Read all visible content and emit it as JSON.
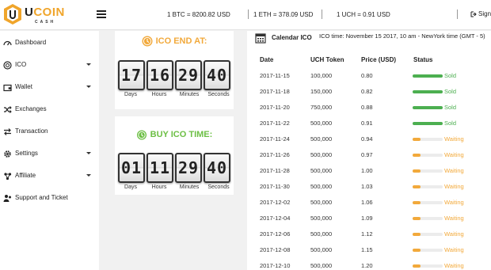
{
  "brand": {
    "name_a": "U",
    "name_b": "COIN",
    "sub": "CASH",
    "primary_color": "#f0a52b"
  },
  "header": {
    "rates": [
      "1 BTC = 8200.82 USD",
      "1 ETH = 378.09 USD",
      "1 UCH = 0.91 USD"
    ],
    "signin": "Sign"
  },
  "sidebar": {
    "items": [
      {
        "label": "Dashboard",
        "icon": "dashboard-icon",
        "has_caret": false
      },
      {
        "label": "ICO",
        "icon": "ico-coin-icon",
        "has_caret": true
      },
      {
        "label": "Wallet",
        "icon": "wallet-icon",
        "has_caret": true
      },
      {
        "label": "Exchanges",
        "icon": "shuffle-icon",
        "has_caret": false
      },
      {
        "label": "Transaction",
        "icon": "transaction-icon",
        "has_caret": false
      },
      {
        "label": "Settings",
        "icon": "gear-icon",
        "has_caret": true
      },
      {
        "label": "Affiliate",
        "icon": "affiliate-icon",
        "has_caret": true
      },
      {
        "label": "Support and Ticket",
        "icon": "support-icon",
        "has_caret": false
      }
    ]
  },
  "ico_end": {
    "title": "ICO END AT:",
    "values": [
      "17",
      "16",
      "29",
      "40"
    ],
    "labels": [
      "Days",
      "Hours",
      "Minutes",
      "Seconds"
    ]
  },
  "buy_ico": {
    "title": "BUY ICO TIME:",
    "values": [
      "01",
      "11",
      "29",
      "40"
    ],
    "labels": [
      "Days",
      "Hours",
      "Minutes",
      "Seconds"
    ]
  },
  "calendar": {
    "title": "Calendar ICO",
    "ico_time": "ICO time: November 15 2017, 10 am - NewYork time (GMT - 5)",
    "columns": [
      "Date",
      "UCH Token",
      "Price (USD)",
      "Status"
    ],
    "sold_color": "#4caf50",
    "waiting_color": "#f2a93b",
    "rows": [
      {
        "date": "2017-11-15",
        "token": "100,000",
        "price": "0.80",
        "status": "Sold",
        "progress": 100
      },
      {
        "date": "2017-11-18",
        "token": "150,000",
        "price": "0.82",
        "status": "Sold",
        "progress": 100
      },
      {
        "date": "2017-11-20",
        "token": "750,000",
        "price": "0.88",
        "status": "Sold",
        "progress": 100
      },
      {
        "date": "2017-11-22",
        "token": "500,000",
        "price": "0.91",
        "status": "Sold",
        "progress": 100
      },
      {
        "date": "2017-11-24",
        "token": "500,000",
        "price": "0.94",
        "status": "Waiting",
        "progress": 25
      },
      {
        "date": "2017-11-26",
        "token": "500,000",
        "price": "0.97",
        "status": "Waiting",
        "progress": 25
      },
      {
        "date": "2017-11-28",
        "token": "500,000",
        "price": "1.00",
        "status": "Waiting",
        "progress": 25
      },
      {
        "date": "2017-11-30",
        "token": "500,000",
        "price": "1.03",
        "status": "Waiting",
        "progress": 25
      },
      {
        "date": "2017-12-02",
        "token": "500,000",
        "price": "1.06",
        "status": "Waiting",
        "progress": 25
      },
      {
        "date": "2017-12-04",
        "token": "500,000",
        "price": "1.09",
        "status": "Waiting",
        "progress": 25
      },
      {
        "date": "2017-12-06",
        "token": "500,000",
        "price": "1.12",
        "status": "Waiting",
        "progress": 25
      },
      {
        "date": "2017-12-08",
        "token": "500,000",
        "price": "1.15",
        "status": "Waiting",
        "progress": 25
      },
      {
        "date": "2017-12-10",
        "token": "500,000",
        "price": "1.20",
        "status": "Waiting",
        "progress": 25
      }
    ]
  }
}
